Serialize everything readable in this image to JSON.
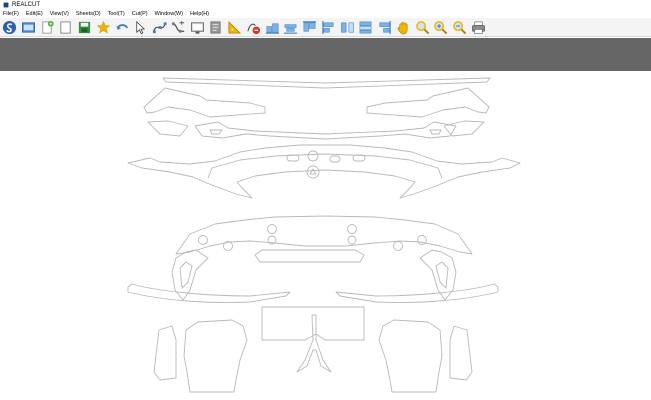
{
  "window": {
    "title": "REALCUT"
  },
  "menu": [
    {
      "label": "File(F)"
    },
    {
      "label": "Edit(E)"
    },
    {
      "label": "View(V)"
    },
    {
      "label": "Sheets(D)"
    },
    {
      "label": "Tool(T)"
    },
    {
      "label": "Cut(P)"
    },
    {
      "label": "Window(W)"
    },
    {
      "label": "Help(H)"
    }
  ],
  "toolbar": [
    {
      "icon": "realcut-logo-icon"
    },
    {
      "icon": "display-icon"
    },
    {
      "icon": "new-file-icon"
    },
    {
      "icon": "blank-page-icon"
    },
    {
      "icon": "save-icon"
    },
    {
      "icon": "star-icon"
    },
    {
      "icon": "undo-icon"
    },
    {
      "icon": "pointer-icon"
    },
    {
      "icon": "node-edit-icon"
    },
    {
      "icon": "node-path-icon"
    },
    {
      "icon": "screen-icon"
    },
    {
      "icon": "sheet-gray-icon"
    },
    {
      "icon": "ruler-triangle-icon"
    },
    {
      "icon": "delete-node-icon"
    },
    {
      "icon": "align-bottom-icon"
    },
    {
      "icon": "align-center-icon"
    },
    {
      "icon": "align-top-icon"
    },
    {
      "icon": "align-left-icon"
    },
    {
      "icon": "distribute-icon"
    },
    {
      "icon": "align-stack-icon"
    },
    {
      "icon": "align-right-icon"
    },
    {
      "icon": "hand-pan-icon"
    },
    {
      "icon": "zoom-icon"
    },
    {
      "icon": "zoom-in-icon"
    },
    {
      "icon": "zoom-out-icon"
    },
    {
      "icon": "print-icon"
    }
  ],
  "colors": {
    "toolbar_bg": "#f4f4f4",
    "band": "#666666",
    "canvas": "#ffffff",
    "part_outline": "#b9b9b9",
    "icon_blue": "#3d7fc4",
    "icon_yellow": "#f0b400"
  }
}
